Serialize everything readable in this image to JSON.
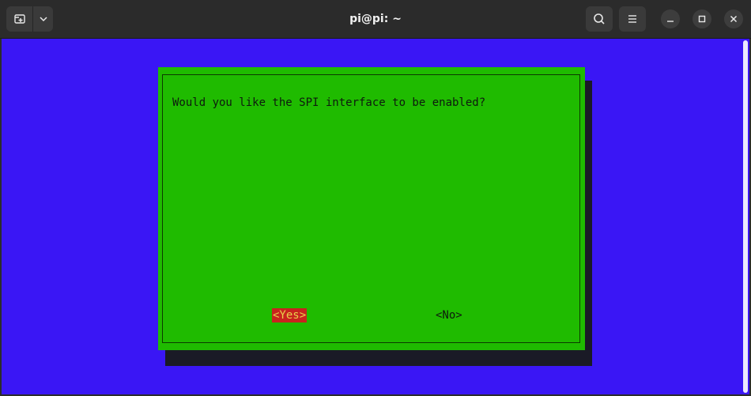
{
  "window": {
    "title": "pi@pi: ~"
  },
  "titlebar": {
    "new_tab_icon": "new-tab-icon",
    "dropdown_icon": "chevron-down-icon",
    "search_icon": "search-icon",
    "menu_icon": "hamburger-menu-icon",
    "minimize_icon": "minimize-icon",
    "maximize_icon": "maximize-icon",
    "close_icon": "close-icon"
  },
  "dialog": {
    "prompt": "Would you like the SPI interface to be enabled?",
    "yes_label": "<Yes>",
    "no_label": "<No>",
    "selected": "<Yes>"
  },
  "colors": {
    "terminal_background": "#3a16f5",
    "dialog_background": "#1fbb00",
    "selected_button_background": "#c8231e",
    "selected_button_text": "#e8d14a"
  }
}
